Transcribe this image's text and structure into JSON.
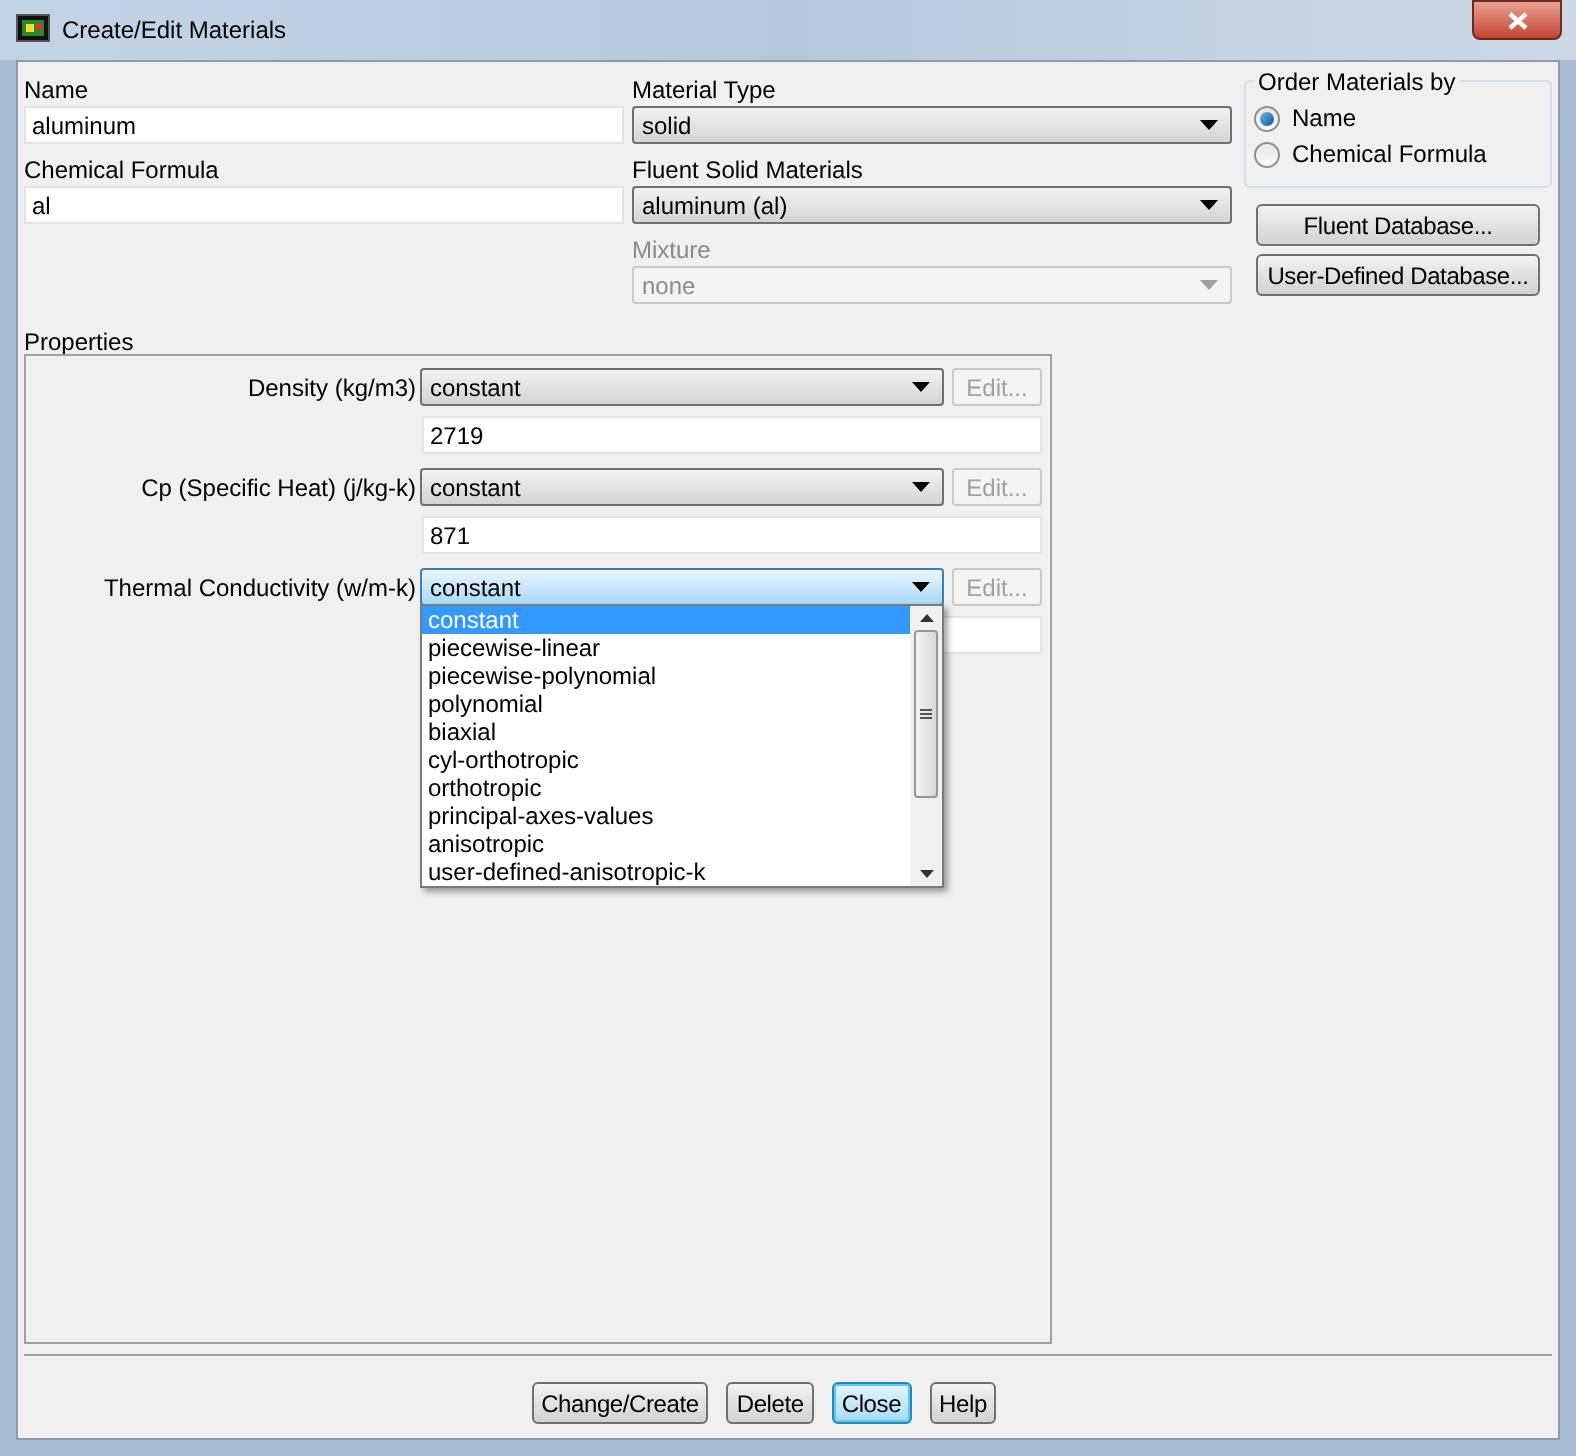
{
  "window": {
    "title": "Create/Edit Materials"
  },
  "name_field": {
    "label": "Name",
    "value": "aluminum"
  },
  "chemical_formula_field": {
    "label": "Chemical Formula",
    "value": "al"
  },
  "material_type": {
    "label": "Material Type",
    "value": "solid",
    "disabled": false
  },
  "fluent_solid_materials": {
    "label": "Fluent Solid Materials",
    "value": "aluminum (al)",
    "disabled": false
  },
  "mixture": {
    "label": "Mixture",
    "value": "none",
    "disabled": true
  },
  "order_materials_by": {
    "label": "Order Materials by",
    "options": [
      {
        "label": "Name",
        "selected": true
      },
      {
        "label": "Chemical Formula",
        "selected": false
      }
    ]
  },
  "database_buttons": [
    "Fluent Database...",
    "User-Defined Database..."
  ],
  "properties": {
    "label": "Properties",
    "rows": [
      {
        "label": "Density (kg/m3)",
        "method": "constant",
        "value": "2719",
        "edit_button": "Edit...",
        "disabled": true,
        "focused": false
      },
      {
        "label": "Cp (Specific Heat) (j/kg-k)",
        "method": "constant",
        "value": "871",
        "edit_button": "Edit...",
        "disabled": true,
        "focused": false
      },
      {
        "label": "Thermal Conductivity (w/m-k)",
        "method": "constant",
        "edit_button": "Edit...",
        "disabled": true,
        "focused": true,
        "expanded": true
      }
    ]
  },
  "dropdown_list": {
    "options": [
      {
        "label": "constant",
        "selected": true
      },
      {
        "label": "piecewise-linear",
        "selected": false
      },
      {
        "label": "piecewise-polynomial",
        "selected": false
      },
      {
        "label": "polynomial",
        "selected": false
      },
      {
        "label": "biaxial",
        "selected": false
      },
      {
        "label": "cyl-orthotropic",
        "selected": false
      },
      {
        "label": "orthotropic",
        "selected": false
      },
      {
        "label": "principal-axes-values",
        "selected": false
      },
      {
        "label": "anisotropic",
        "selected": false
      },
      {
        "label": "user-defined-anisotropic-k",
        "selected": false
      }
    ]
  },
  "buttons": [
    {
      "label": "Change/Create",
      "default": false
    },
    {
      "label": "Delete",
      "default": false
    },
    {
      "label": "Close",
      "default": true
    },
    {
      "label": "Help",
      "default": false
    }
  ]
}
